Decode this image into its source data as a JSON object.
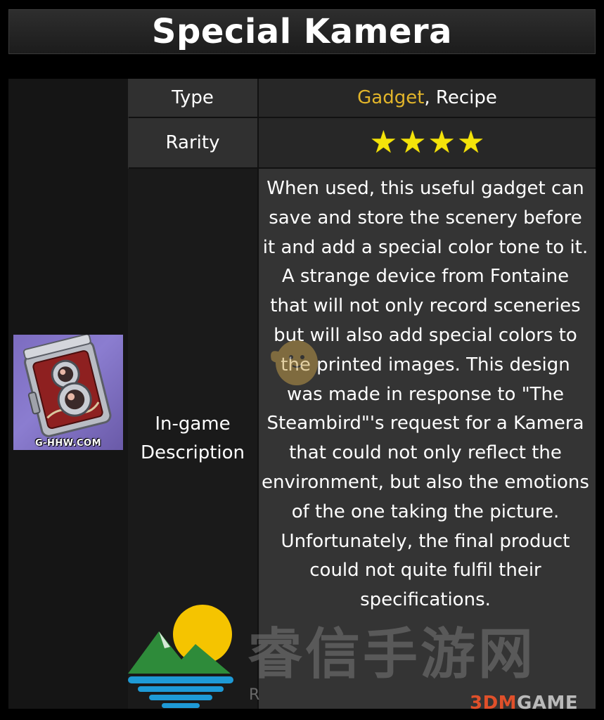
{
  "title": "Special Kamera",
  "image": {
    "caption": "G-HHW.COM"
  },
  "rows": {
    "type": {
      "label": "Type",
      "value_link": "Gadget",
      "value_rest": ", Recipe"
    },
    "rarity": {
      "label": "Rarity",
      "stars": 4,
      "star_glyph": "★"
    },
    "description": {
      "label_line1": "In-game",
      "label_line2": "Description",
      "text": "When used, this useful gadget can save and store the scenery before it and add a special color tone to it.\nA strange device from Fontaine that will not only record sceneries but will also add special colors to the printed images. This design was made in response to \"The Steambird\"'s request for a Kamera that could not only reflect the environment, but also the emotions of the one taking the picture.\nUnfortunately, the final product could not quite fulfil their specifications."
    }
  },
  "watermarks": {
    "site_text": "睿信手游网",
    "letter": "R",
    "brand_prefix": "3DM",
    "brand_suffix": "GAME"
  },
  "colors": {
    "background": "#000000",
    "cell_dark": "#303030",
    "link_gold": "#e2b52a",
    "star_yellow": "#f4e30a"
  }
}
